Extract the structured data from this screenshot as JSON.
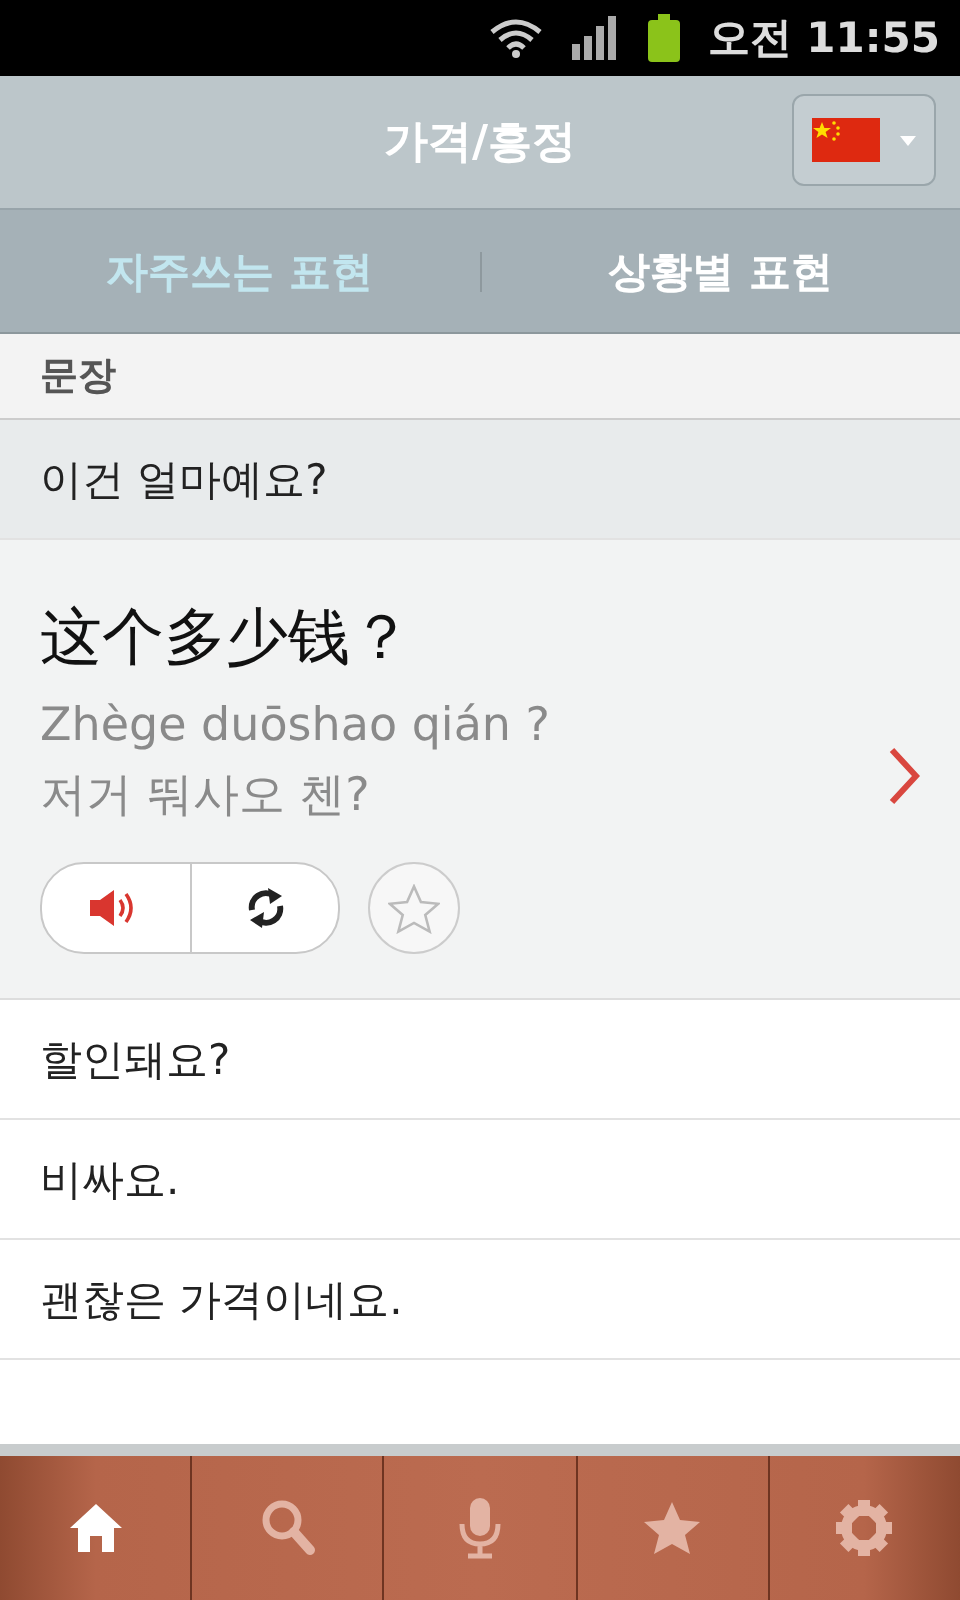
{
  "status_bar": {
    "time": "오전 11:55"
  },
  "header": {
    "title": "가격/흥정"
  },
  "tabs": [
    {
      "label": "자주쓰는 표현",
      "selected": true
    },
    {
      "label": "상황별 표현",
      "selected": false
    }
  ],
  "section": {
    "title": "문장"
  },
  "phrases": [
    {
      "text": "이건 얼마예요?",
      "selected": true,
      "expanded": true,
      "chinese": "这个多少钱？",
      "pinyin": "Zhège duōshao qián ?",
      "pronunciation": "저거 뚸사오 첸?",
      "favorite": false
    },
    {
      "text": "할인돼요?",
      "selected": false,
      "expanded": false
    },
    {
      "text": "비싸요.",
      "selected": false,
      "expanded": false
    },
    {
      "text": "괜찮은 가격이네요.",
      "selected": false,
      "expanded": false
    }
  ],
  "nav": [
    {
      "kind": "home",
      "selected": true
    },
    {
      "kind": "search",
      "selected": false
    },
    {
      "kind": "mic",
      "selected": false
    },
    {
      "kind": "star",
      "selected": false
    },
    {
      "kind": "settings",
      "selected": false
    }
  ]
}
